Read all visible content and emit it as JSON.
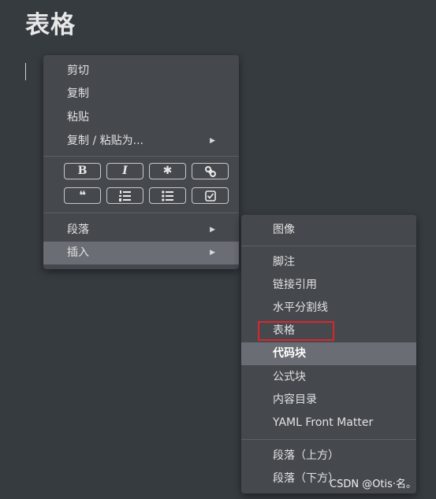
{
  "page": {
    "title": "表格"
  },
  "context_menu": {
    "items_top": [
      "剪切",
      "复制",
      "粘贴",
      "复制 / 粘贴为..."
    ],
    "format_buttons": [
      {
        "icon": "bold-icon",
        "glyph": "B"
      },
      {
        "icon": "italic-icon",
        "glyph": "I"
      },
      {
        "icon": "code-icon",
        "glyph": "✱"
      },
      {
        "icon": "link-icon",
        "glyph": ""
      },
      {
        "icon": "quote-icon",
        "glyph": "❝"
      },
      {
        "icon": "ordered-list-icon",
        "glyph": ""
      },
      {
        "icon": "unordered-list-icon",
        "glyph": ""
      },
      {
        "icon": "task-list-icon",
        "glyph": ""
      }
    ],
    "items_bottom": [
      "段落",
      "插入"
    ]
  },
  "submenu_insert": {
    "items": [
      "图像",
      "脚注",
      "链接引用",
      "水平分割线",
      "表格",
      "代码块",
      "公式块",
      "内容目录",
      "YAML Front Matter",
      "段落（上方）",
      "段落（下方）"
    ],
    "highlighted": "代码块",
    "outlined": "表格"
  },
  "colors": {
    "background": "#363b40",
    "menu": "#45494e",
    "hover": "#6a6d73",
    "outline": "#d9262c"
  },
  "watermark": "CSDN @Otis·名。"
}
